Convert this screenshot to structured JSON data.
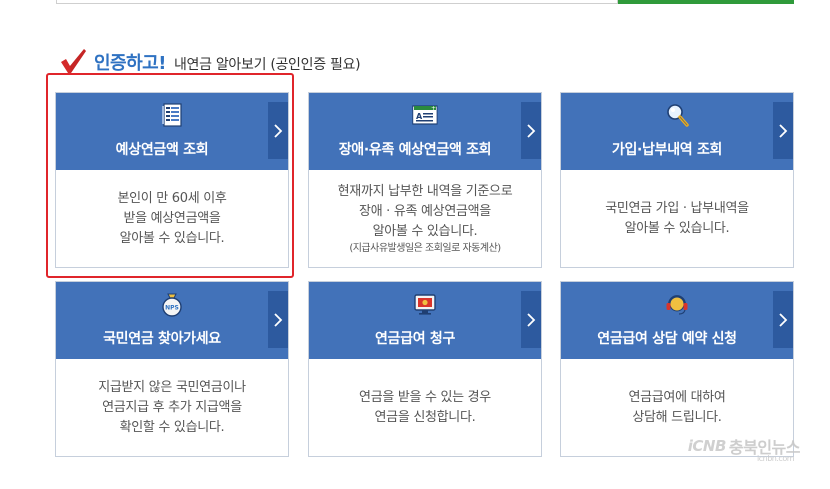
{
  "heading": {
    "main": "인증하고!",
    "sub": "내연금 알아보기 (공인인증 필요)"
  },
  "cards": [
    {
      "title": "예상연금액 조회",
      "icon": "document-list-icon",
      "lines": [
        "본인이 만 60세 이후",
        "받을 예상연금액을",
        "알아볼 수 있습니다."
      ],
      "note": ""
    },
    {
      "title": "장애·유족 예상연금액 조회",
      "icon": "id-card-icon",
      "lines": [
        "현재까지 납부한 내역을 기준으로",
        "장애  · 유족 예상연금액을",
        "알아볼 수 있습니다."
      ],
      "note": "(지급사유발생일은 조회일로 자동계산)"
    },
    {
      "title": "가입·납부내역 조회",
      "icon": "magnifier-icon",
      "lines": [
        "국민연금 가입  · 납부내역을",
        "알아볼 수 있습니다."
      ],
      "note": ""
    },
    {
      "title": "국민연금 찾아가세요",
      "icon": "nps-pouch-icon",
      "lines": [
        "지급받지 않은 국민연금이나",
        "연금지급 후 추가 지급액을",
        "확인할 수 있습니다."
      ],
      "note": ""
    },
    {
      "title": "연금급여 청구",
      "icon": "monitor-icon",
      "lines": [
        "연금을 받을 수 있는 경우",
        "연금을 신청합니다."
      ],
      "note": ""
    },
    {
      "title": "연금급여 상담 예약 신청",
      "icon": "headset-icon",
      "lines": [
        "연금급여에 대하여",
        "상담해 드립니다."
      ],
      "note": ""
    }
  ],
  "watermark": {
    "logo": "iCNB",
    "name": "충북인뉴스",
    "url": "icnbn.com"
  },
  "colors": {
    "card_head": "#4272b9",
    "card_arrow": "#2d5a9f",
    "heading_blue": "#2f72c2",
    "highlight_red": "#e0252b",
    "check_red": "#d42a2a"
  }
}
